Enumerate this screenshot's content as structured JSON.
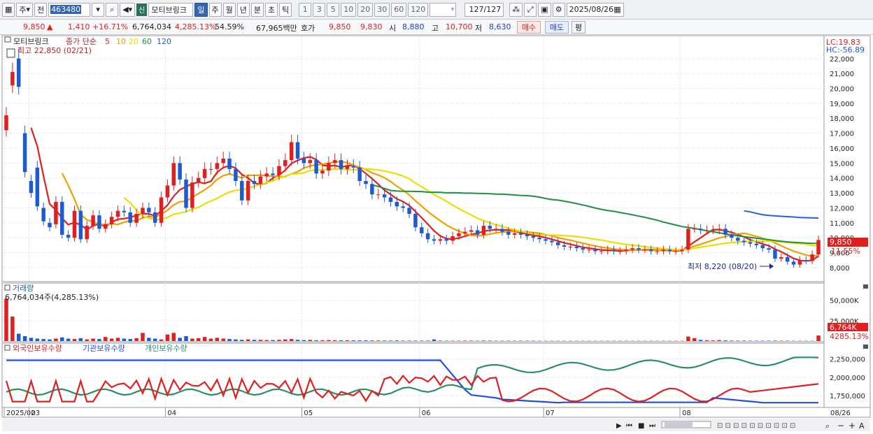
{
  "toolbar": {
    "period_type": "주",
    "prev_label": "전",
    "stock_code": "463480",
    "credit_badge": "신",
    "stock_name": "모티브링크",
    "period_tabs": [
      "일",
      "주",
      "월",
      "년",
      "분",
      "초",
      "틱"
    ],
    "active_period": "일",
    "intervals": [
      "1",
      "3",
      "5",
      "10",
      "20",
      "30",
      "60",
      "120"
    ],
    "count": "127",
    "count_total": "/127",
    "date": "2025/08/26"
  },
  "quote": {
    "price": "9,850",
    "change_arrow": "▲",
    "change": "1,410",
    "change_pct": "+16.71%",
    "volume": "6,764,034",
    "volume_ratio": "4,285.13%",
    "turnover": "54.59%",
    "trade_value": "67,965백만",
    "ask_label": "호가",
    "ask": "9,850",
    "bid": "9,830",
    "open_label": "시",
    "open": "8,880",
    "high_label": "고",
    "high": "10,700",
    "low_label": "저",
    "low": "8,630",
    "buy_label": "매수",
    "sell_label": "매도",
    "eval_label": "평"
  },
  "legend": {
    "stock_name": "모티브링크",
    "ma_label": "종가 단순",
    "ma_periods": [
      "5",
      "10",
      "20",
      "60",
      "120"
    ],
    "ma_colors": [
      "#e02020",
      "#f0a000",
      "#e8e000",
      "#1e9040",
      "#2060e0"
    ],
    "max_label": "최고 22,850 (02/21)",
    "min_label": "최저 8,220 (08/20)",
    "lc": "LC:19.83",
    "hc": "HC:-56.89"
  },
  "volume_panel": {
    "title": "거래량",
    "info": "6,764,034주(4,285.13%)",
    "last_label": "6,764K",
    "last_pct": "4285.13%",
    "ticks": [
      "50,000K",
      "25,000K"
    ]
  },
  "holding_panel": {
    "legend": [
      "외국인보유수량",
      "기관보유수량",
      "개인보유수량"
    ],
    "ticks": [
      "2,250,000",
      "2,000,000",
      "1,750,000"
    ]
  },
  "price_panel": {
    "last_label": "9,850",
    "last_pct": "11.55%",
    "ticks": [
      "22,000",
      "21,000",
      "20,000",
      "19,000",
      "18,000",
      "17,000",
      "16,000",
      "15,000",
      "14,000",
      "13,000",
      "12,000",
      "11,000",
      "10,000",
      "9,000",
      "8,000"
    ]
  },
  "x_axis": {
    "labels": [
      "2025/02",
      "03",
      "04",
      "05",
      "06",
      "07",
      "08"
    ],
    "end_label": "08/26"
  },
  "chart_data": [
    {
      "type": "candlestick",
      "title": "모티브링크",
      "ylim": [
        7200,
        23300
      ],
      "x": [
        "02/21",
        "02/24",
        "02/25",
        "02/26",
        "02/27",
        "02/28",
        "03/04",
        "03/05",
        "03/06",
        "03/07",
        "03/10",
        "03/11",
        "03/12",
        "03/13",
        "03/14",
        "03/17",
        "03/18",
        "03/19",
        "03/20",
        "03/21",
        "03/24",
        "03/25",
        "03/26",
        "03/27",
        "03/28",
        "03/31",
        "04/01",
        "04/02",
        "04/03",
        "04/04",
        "04/07",
        "04/08",
        "04/09",
        "04/10",
        "04/11",
        "04/14",
        "04/15",
        "04/16",
        "04/17",
        "04/18",
        "04/21",
        "04/22",
        "04/23",
        "04/24",
        "04/25",
        "04/28",
        "04/29",
        "04/30",
        "05/02",
        "05/07",
        "05/08",
        "05/09",
        "05/12",
        "05/13",
        "05/14",
        "05/15",
        "05/16",
        "05/19",
        "05/20",
        "05/21",
        "05/22",
        "05/23",
        "05/26",
        "05/27",
        "05/28",
        "05/29",
        "05/30",
        "06/02",
        "06/04",
        "06/05",
        "06/09",
        "06/10",
        "06/11",
        "06/12",
        "06/13",
        "06/16",
        "06/17",
        "06/18",
        "06/19",
        "06/20",
        "06/23",
        "06/24",
        "06/25",
        "06/26",
        "06/27",
        "06/30",
        "07/01",
        "07/02",
        "07/03",
        "07/04",
        "07/07",
        "07/08",
        "07/09",
        "07/10",
        "07/11",
        "07/14",
        "07/15",
        "07/16",
        "07/17",
        "07/18",
        "07/21",
        "07/22",
        "07/23",
        "07/24",
        "07/25",
        "07/28",
        "07/29",
        "07/30",
        "07/31",
        "08/01",
        "08/04",
        "08/05",
        "08/06",
        "08/07",
        "08/08",
        "08/11",
        "08/12",
        "08/13",
        "08/14",
        "08/18",
        "08/19",
        "08/20",
        "08/21",
        "08/22",
        "08/25",
        "08/26"
      ],
      "open": [
        17200,
        20200,
        22000,
        17000,
        13800,
        14700,
        12000,
        11000,
        10900,
        12400,
        10200,
        10000,
        11800,
        9900,
        10800,
        11500,
        10600,
        10900,
        11400,
        11800,
        11700,
        11000,
        11600,
        12000,
        11700,
        11000,
        12700,
        13500,
        15000,
        13900,
        12000,
        13700,
        14000,
        14600,
        14600,
        15000,
        15300,
        14600,
        13800,
        12500,
        13800,
        13600,
        14100,
        14300,
        14200,
        14800,
        15200,
        16400,
        15300,
        15000,
        15200,
        14300,
        14500,
        15000,
        15200,
        14600,
        14800,
        14700,
        13800,
        13600,
        12900,
        12900,
        12700,
        12400,
        12100,
        12000,
        11600,
        10700,
        10300,
        9900,
        9800,
        9900,
        9800,
        10100,
        10300,
        10400,
        10500,
        10200,
        10800,
        10600,
        10600,
        10400,
        10200,
        10300,
        10200,
        10100,
        10000,
        9900,
        9800,
        9700,
        9500,
        9400,
        9400,
        9300,
        9200,
        9200,
        9100,
        9100,
        9200,
        9100,
        9100,
        9200,
        9300,
        9200,
        9200,
        9100,
        9100,
        9200,
        9100,
        9100,
        9200,
        10600,
        10600,
        10500,
        10500,
        10500,
        10600,
        10200,
        10000,
        9800,
        9700,
        9600,
        9500,
        9300,
        9200,
        8600,
        8700,
        8400,
        8200,
        8500,
        8440,
        8880
      ],
      "close": [
        18200,
        21100,
        20100,
        14400,
        13000,
        12100,
        11100,
        10700,
        12400,
        10200,
        10000,
        11800,
        9900,
        10800,
        11500,
        10600,
        10900,
        11400,
        11800,
        11700,
        11000,
        11600,
        12000,
        11700,
        11000,
        12700,
        13500,
        15000,
        13900,
        12000,
        13700,
        14000,
        14600,
        14600,
        15000,
        15300,
        14600,
        13800,
        12500,
        13800,
        13600,
        14100,
        14300,
        14200,
        14800,
        15200,
        16400,
        15300,
        15000,
        15200,
        14300,
        14500,
        15000,
        15200,
        14600,
        14800,
        14700,
        13800,
        13600,
        12900,
        12900,
        12700,
        12400,
        12100,
        12000,
        11600,
        10700,
        10300,
        9900,
        9800,
        9900,
        9800,
        10100,
        10300,
        10400,
        10500,
        10200,
        10800,
        10600,
        10600,
        10400,
        10200,
        10300,
        10200,
        10100,
        10000,
        9900,
        9800,
        9700,
        9500,
        9400,
        9400,
        9300,
        9200,
        9200,
        9100,
        9100,
        9200,
        9100,
        9100,
        9200,
        9300,
        9200,
        9200,
        9100,
        9100,
        9200,
        9100,
        9100,
        9200,
        10600,
        10600,
        10500,
        10500,
        10500,
        10600,
        10200,
        10000,
        9800,
        9700,
        9600,
        9500,
        9300,
        9200,
        8600,
        8700,
        8400,
        8200,
        8500,
        8440,
        8880,
        9850
      ],
      "volume_k": [
        52000,
        30000,
        9000,
        6000,
        4000,
        3000,
        2500,
        2000,
        3000,
        4500,
        3000,
        2500,
        3500,
        2000,
        3000,
        2500,
        5000,
        3000,
        4000,
        3000,
        2500,
        3500,
        10000,
        4000,
        3000,
        2000,
        8000,
        10000,
        4000,
        6000,
        3000,
        3500,
        5000,
        3000,
        4000,
        3000,
        2500,
        2000,
        1500,
        2000,
        1500,
        1500,
        1200,
        1200,
        1500,
        2000,
        2500,
        1500,
        1200,
        1500,
        1000,
        1000,
        1200,
        1000,
        900,
        900,
        800,
        800,
        800,
        700,
        700,
        600,
        600,
        700,
        500,
        500,
        500,
        500,
        500,
        2000,
        500,
        400,
        400,
        400,
        500,
        500,
        400,
        600,
        500,
        400,
        400,
        400,
        400,
        400,
        400,
        400,
        300,
        300,
        300,
        300,
        300,
        300,
        300,
        300,
        300,
        300,
        300,
        300,
        300,
        300,
        300,
        300,
        300,
        300,
        300,
        300,
        300,
        300,
        300,
        300,
        5500,
        3500,
        1500,
        1000,
        800,
        1200,
        800,
        600,
        500,
        500,
        400,
        400,
        400,
        400,
        500,
        400,
        400,
        300,
        300,
        300,
        300,
        6764
      ],
      "annotations": [
        {
          "label": "최고 22,850 (02/21)",
          "value": 22850
        },
        {
          "label": "최저 8,220 (08/20)",
          "value": 8220
        }
      ]
    },
    {
      "type": "line",
      "title": "보유수량",
      "series": [
        {
          "name": "외국인보유수량",
          "color": "#e02020"
        },
        {
          "name": "기관보유수량",
          "color": "#2050e0"
        },
        {
          "name": "개인보유수량",
          "color": "#2a9060"
        }
      ]
    }
  ]
}
